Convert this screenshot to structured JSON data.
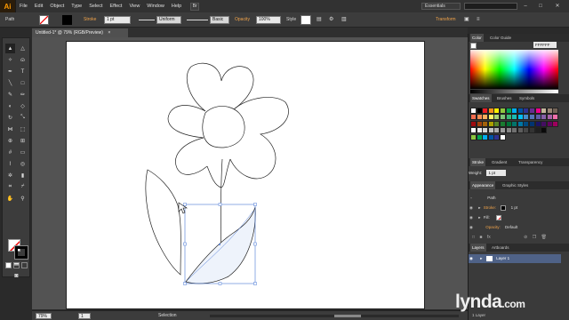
{
  "app": {
    "logo": "Ai",
    "bridge_label": "Br"
  },
  "menu": [
    "File",
    "Edit",
    "Object",
    "Type",
    "Select",
    "Effect",
    "View",
    "Window",
    "Help"
  ],
  "workspace": {
    "label": "Essentials"
  },
  "window_controls": {
    "minimize": "–",
    "maximize": "□",
    "close": "✕"
  },
  "control_bar": {
    "selection_label": "Path",
    "stroke_label": "Stroke",
    "stroke_value": "1 pt",
    "profile": "Uniform",
    "brush": "Basic",
    "opacity_label": "Opacity",
    "opacity_value": "100%",
    "style_label": "Style",
    "transform_label": "Transform"
  },
  "document": {
    "tab_title": "Untitled-1* @ 79% (RGB/Preview)",
    "tab_close": "×"
  },
  "status_bar": {
    "zoom": "79%",
    "page": "1",
    "tool": "Selection"
  },
  "panels": {
    "color": {
      "tab_color": "Color",
      "tab_guide": "Color Guide",
      "hex": "FFFFFF"
    },
    "swatches": {
      "tab_swatches": "Swatches",
      "tab_brushes": "Brushes",
      "tab_symbols": "Symbols"
    },
    "stroke": {
      "tab_stroke": "Stroke",
      "tab_gradient": "Gradient",
      "tab_transparency": "Transparency",
      "weight_label": "Weight:",
      "weight_value": "1 pt"
    },
    "appearance": {
      "tab_appearance": "Appearance",
      "tab_graphic_styles": "Graphic Styles",
      "rows": [
        {
          "label": "Path"
        },
        {
          "label": "Stroke:",
          "value": "1 pt"
        },
        {
          "label": "Fill:"
        },
        {
          "label": "Opacity:",
          "value": "Default"
        }
      ]
    },
    "layers": {
      "tab_layers": "Layers",
      "tab_artboards": "Artboards",
      "layer_name": "Layer 1",
      "footer": "1 Layer"
    }
  },
  "watermark": {
    "brand": "lynda",
    "suffix": ".com"
  },
  "colors": {
    "accent_orange": "#ff9a00",
    "selection_blue": "#4a78d6",
    "layer_highlight": "#4f6287"
  }
}
